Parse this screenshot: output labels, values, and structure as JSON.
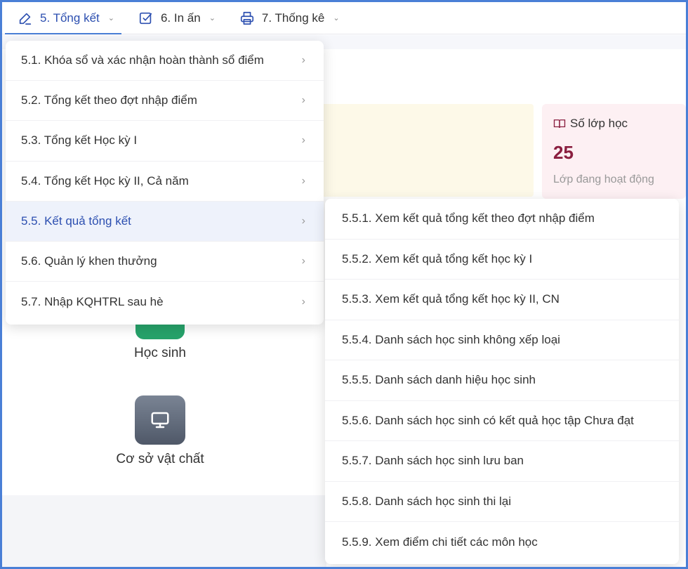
{
  "nav": {
    "items": [
      {
        "label": "5. Tổng kết",
        "icon": "pencil-icon",
        "active": true
      },
      {
        "label": "6. In ấn",
        "icon": "checkbox-icon",
        "active": false
      },
      {
        "label": "7. Thống kê",
        "icon": "printer-icon",
        "active": false
      }
    ]
  },
  "stats_card": {
    "title": "Số lớp học",
    "icon": "book-icon",
    "value": "25",
    "subtitle": "Lớp đang hoạt động"
  },
  "tiles": [
    {
      "label": "Học sinh",
      "icon": "student-icon"
    },
    {
      "label": "Cơ sở vật chất",
      "icon": "monitor-icon"
    }
  ],
  "menu_level1": {
    "items": [
      "5.1. Khóa sổ và xác nhận hoàn thành sổ điểm",
      "5.2. Tổng kết theo đợt nhập điểm",
      "5.3. Tổng kết Học kỳ I",
      "5.4. Tổng kết Học kỳ II, Cả năm",
      "5.5. Kết quả tổng kết",
      "5.6. Quản lý khen thưởng",
      "5.7. Nhập KQHTRL sau hè"
    ],
    "active_index": 4,
    "arrow": "›"
  },
  "menu_level2": {
    "items": [
      "5.5.1. Xem kết quả tổng kết theo đợt nhập điểm",
      "5.5.2. Xem kết quả tổng kết học kỳ I",
      "5.5.3. Xem kết quả tổng kết học kỳ II, CN",
      "5.5.4. Danh sách học sinh không xếp loại",
      "5.5.5. Danh sách danh hiệu học sinh",
      "5.5.6. Danh sách học sinh có kết quả học tập Chưa đạt",
      "5.5.7. Danh sách học sinh lưu ban",
      "5.5.8. Danh sách học sinh thi lại",
      "5.5.9. Xem điểm chi tiết các môn học"
    ]
  },
  "colors": {
    "accent": "#2c4fb0",
    "frame": "#4a7fd6",
    "stat_value": "#8a1e3f",
    "green_tile": "#26a26a"
  }
}
